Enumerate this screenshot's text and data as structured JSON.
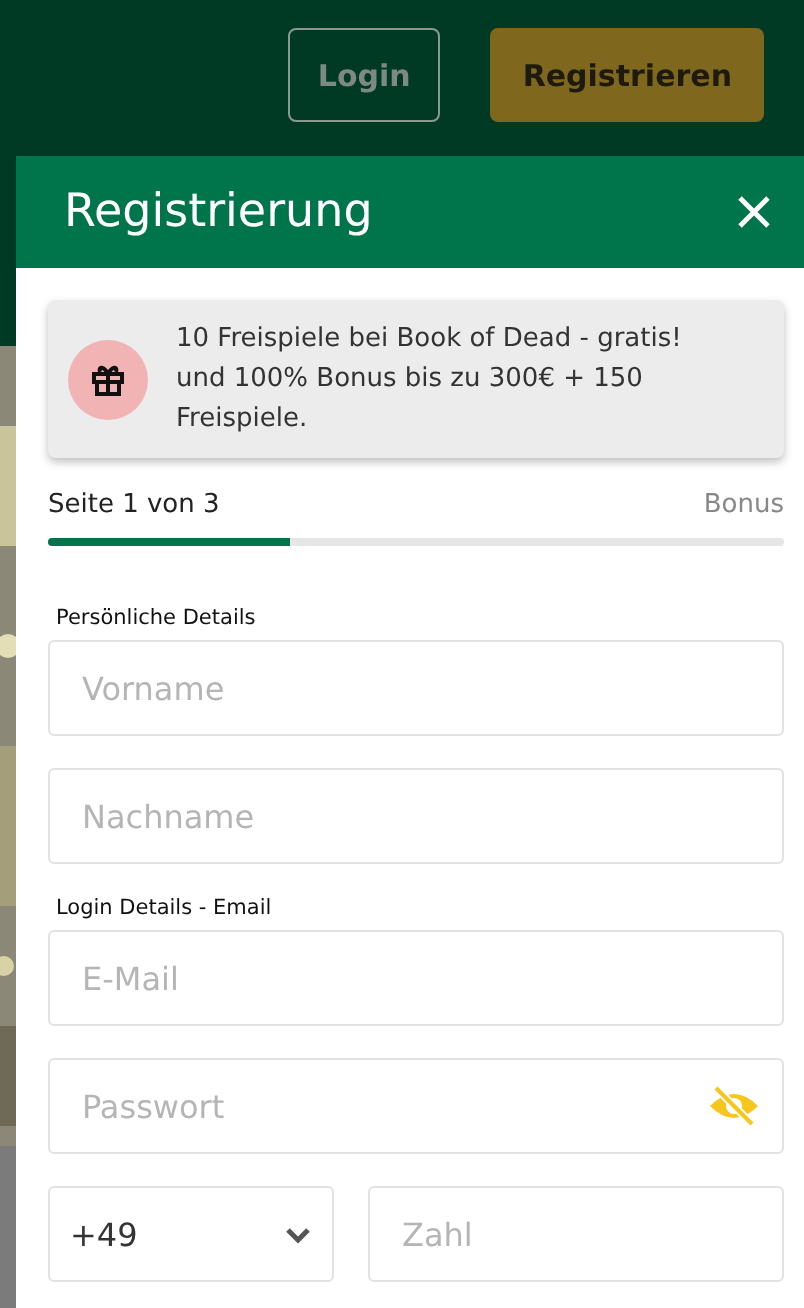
{
  "header": {
    "buttons": [
      {
        "label": "Login",
        "kind": "outline"
      },
      {
        "label": "Registrieren",
        "kind": "primary"
      }
    ]
  },
  "modal": {
    "title": "Registrierung",
    "promo": {
      "text": "10 Freispiele bei Book of Dead - gratis! und 100% Bonus bis zu 300€ + 150 Freispiele."
    },
    "progress": {
      "step": "Seite 1 von 3",
      "next": "Bonus",
      "level": 0.33
    },
    "sections": [
      {
        "heading": "Persönliche Details",
        "fields": [
          {
            "kind": "text",
            "placeholder": "Vorname"
          },
          {
            "kind": "text",
            "placeholder": "Nachname"
          }
        ]
      },
      {
        "heading": "Login Details - Email",
        "fields": [
          {
            "kind": "text",
            "placeholder": "E-Mail"
          },
          {
            "kind": "password",
            "placeholder": "Passwort"
          },
          {
            "kind": "phone",
            "code": "+49",
            "placeholder": "Zahl"
          }
        ]
      }
    ]
  }
}
